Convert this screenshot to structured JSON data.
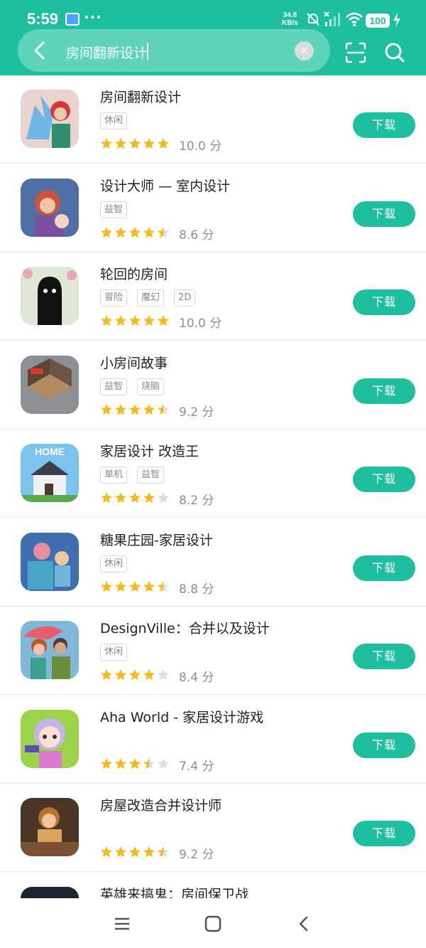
{
  "status_bar": {
    "time": "5:59",
    "net_speed_value": "34.8",
    "net_speed_unit": "KB/s",
    "battery": "100",
    "icons": [
      "mail-notification-icon",
      "more-dots-icon",
      "mute-icon",
      "signal-icon",
      "wifi-icon",
      "charging-icon"
    ]
  },
  "search": {
    "query": "房间翻新设计",
    "clear_label": "×"
  },
  "apps": [
    {
      "name": "房间翻新设计",
      "tags": [
        "休闲"
      ],
      "rating": 5,
      "score": "10.0 分",
      "button": "下载"
    },
    {
      "name": "设计大师 — 室内设计",
      "tags": [
        "益智"
      ],
      "rating": 4.5,
      "score": "8.6 分",
      "button": "下载"
    },
    {
      "name": "轮回的房间",
      "tags": [
        "冒险",
        "魔幻",
        "2D"
      ],
      "rating": 5,
      "score": "10.0 分",
      "button": "下载"
    },
    {
      "name": "小房间故事",
      "tags": [
        "益智",
        "烧脑"
      ],
      "rating": 4.5,
      "score": "9.2 分",
      "button": "下载"
    },
    {
      "name": "家居设计 改造王",
      "tags": [
        "单机",
        "益智"
      ],
      "rating": 4,
      "score": "8.2 分",
      "button": "下载"
    },
    {
      "name": "糖果庄园-家居设计",
      "tags": [
        "休闲"
      ],
      "rating": 4.5,
      "score": "8.8 分",
      "button": "下载"
    },
    {
      "name": "DesignVille：合并以及设计",
      "tags": [
        "休闲"
      ],
      "rating": 4,
      "score": "8.4 分",
      "button": "下载"
    },
    {
      "name": "Aha World - 家居设计游戏",
      "tags": [],
      "rating": 3.5,
      "score": "7.4 分",
      "button": "下载"
    },
    {
      "name": "房屋改造合并设计师",
      "tags": [],
      "rating": 4.5,
      "score": "9.2 分",
      "button": "下载"
    },
    {
      "name": "英雄来搞鬼：房间保卫战",
      "tags": [],
      "rating": 0,
      "score": "",
      "button": ""
    }
  ],
  "colors": {
    "accent": "#1dbf9f",
    "star": "#f6b91a",
    "star_empty": "#dddddd"
  }
}
